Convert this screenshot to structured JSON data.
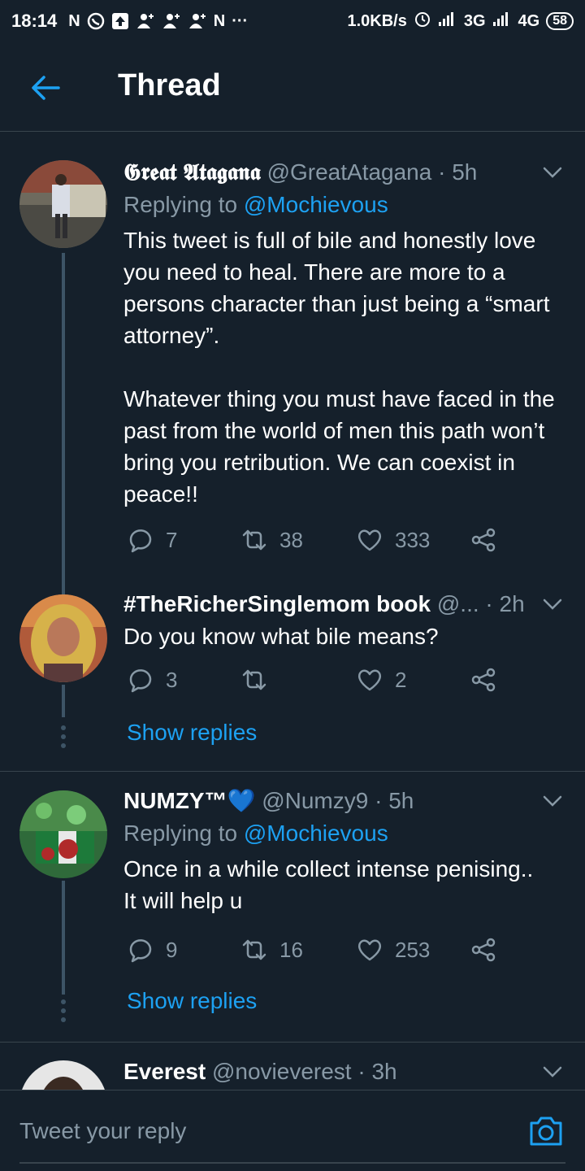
{
  "status_bar": {
    "time": "18:14",
    "speed": "1.0KB/s",
    "net1": "3G",
    "net2": "4G",
    "battery": "58"
  },
  "header": {
    "title": "Thread"
  },
  "tweets": [
    {
      "name": "𝕲𝖗𝖊𝖆𝖙 𝕬𝖙𝖆𝖌𝖆𝖓𝖆",
      "handle": "@GreatAtagana",
      "time": "· 5h",
      "replying_prefix": "Replying to",
      "replying_to": "@Mochievous",
      "text": "This tweet is full of bile and honestly love you need to heal. There are more to a persons character than just being a “smart attorney”.\n\nWhatever thing you must have faced in the past from the world of men this path won’t bring you retribution. We can coexist in peace!!",
      "replies": "7",
      "retweets": "38",
      "likes": "333"
    },
    {
      "name": "#TheRicherSinglemom book",
      "handle": "@...",
      "time": "· 2h",
      "text": "Do you know what bile means?",
      "replies": "3",
      "retweets": "",
      "likes": "2",
      "show_replies": "Show replies"
    },
    {
      "name": "NUMZY™💙",
      "handle": "@Numzy9",
      "time": "· 5h",
      "replying_prefix": "Replying to",
      "replying_to": "@Mochievous",
      "text": "Once in a while collect intense penising..\nIt will help u",
      "replies": "9",
      "retweets": "16",
      "likes": "253",
      "show_replies": "Show replies"
    },
    {
      "name": "Everest",
      "handle": "@novieverest",
      "time": "· 3h"
    }
  ],
  "composer": {
    "placeholder": "Tweet your reply"
  },
  "colors": {
    "background": "#15202b",
    "accent": "#1da1f2",
    "muted": "#8899a6",
    "divider": "#38444d"
  }
}
